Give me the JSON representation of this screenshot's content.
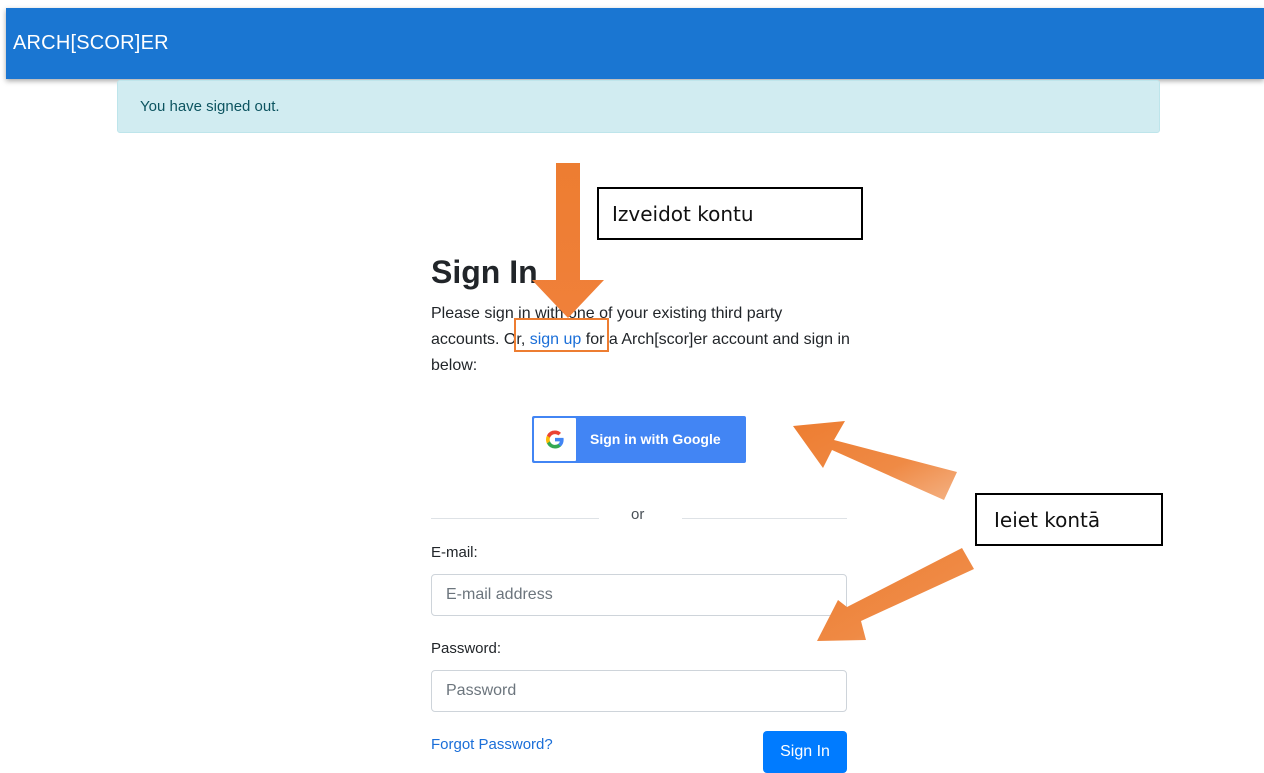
{
  "header": {
    "brand": "ARCH[SCOR]ER"
  },
  "alert": {
    "message": "You have signed out."
  },
  "signin": {
    "title": "Sign In",
    "intro_before": "Please sign in with one of your existing third party accounts. Or, ",
    "signup_link": "sign up",
    "intro_after": " for a Arch[scor]er account and sign in below:",
    "google_button": "Sign in with Google",
    "divider": "or",
    "email_label": "E-mail:",
    "email_placeholder": "E-mail address",
    "email_value": "",
    "password_label": "Password:",
    "password_placeholder": "Password",
    "password_value": "",
    "forgot_link": "Forgot Password?",
    "submit_button": "Sign In"
  },
  "annotations": {
    "create_account": "Izveidot kontu",
    "log_in": "Ieiet kontā"
  },
  "colors": {
    "header": "#1a76d2",
    "alert_bg": "#d1ecf1",
    "alert_text": "#0c5460",
    "google_blue": "#4285f4",
    "primary": "#007bff",
    "arrow": "#ed7d31"
  },
  "icons": {
    "google": "google-g-icon",
    "arrow": "arrow-icon"
  }
}
